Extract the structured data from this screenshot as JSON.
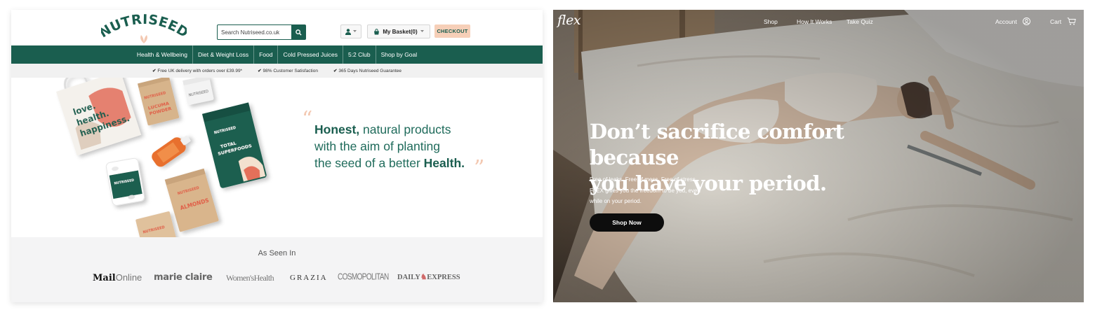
{
  "nutriseed": {
    "logo_text": "NUTRISEED",
    "search": {
      "placeholder": "Search Nutriseed.co.uk"
    },
    "basket_label": "My Basket(0)",
    "checkout_label": "CHECKOUT",
    "nav": [
      "Health & Wellbeing",
      "Diet & Weight Loss",
      "Food",
      "Cold Pressed Juices",
      "5:2 Club",
      "Shop by Goal"
    ],
    "usps": [
      "Free UK delivery with orders over £39.99*",
      "98% Customer Satisfaction",
      "365 Days Nutriseed Guarantee"
    ],
    "hero": {
      "line1_bold": "Honest,",
      "line1_rest": " natural products",
      "line2": "with the aim of planting",
      "line3_rest": "the seed of a better ",
      "line3_bold": "Health."
    },
    "products": {
      "tote": "love. health. happiness.",
      "lucuma": "LUCUMA POWDER",
      "superfoods": "TOTAL SUPERFOODS",
      "almonds": "ALMONDS",
      "brand_small": "NUTRISEED"
    },
    "as_seen_in": "As Seen In",
    "publications": {
      "mail_bold": "Mail",
      "mail_rest": "Online",
      "marie_claire": "marie claire",
      "womens_health": "Women'sHealth",
      "grazia": "GRAZIA",
      "cosmopolitan": "COSMOPOLITAN",
      "express_1": "DAILY",
      "express_2": "EXPRESS"
    },
    "colors": {
      "brand_green": "#1a5e4f",
      "checkout_peach": "#f6cfb8"
    }
  },
  "flex": {
    "logo": "flex",
    "nav": {
      "shop": "Shop",
      "how": "How It Works",
      "quiz": "Take Quiz",
      "account": "Account",
      "cart": "Cart"
    },
    "headline_1": "Don’t sacrifice comfort because",
    "headline_2": "you have your period.",
    "subtext_1": "Free of leaks. Free of mess. Free of stress.",
    "subtext_2": "FLEX gives you the freedom to be you, even",
    "subtext_3": "while on your period.",
    "cta": "Shop Now"
  }
}
